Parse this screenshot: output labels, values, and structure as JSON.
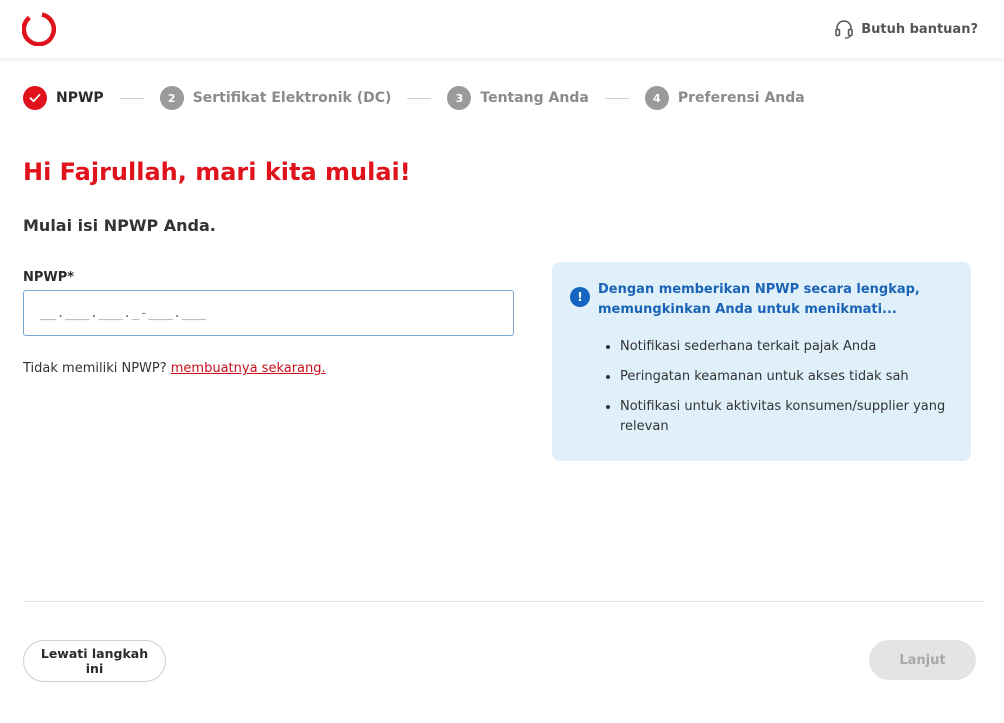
{
  "header": {
    "logo": "brand-ring-logo",
    "help_label": "Butuh bantuan?",
    "help_icon": "headset-icon"
  },
  "stepper": {
    "steps": [
      {
        "number": "1",
        "label": "NPWP",
        "state": "completed"
      },
      {
        "number": "2",
        "label": "Sertifikat Elektronik (DC)",
        "state": "pending"
      },
      {
        "number": "3",
        "label": "Tentang Anda",
        "state": "pending"
      },
      {
        "number": "4",
        "label": "Preferensi Anda",
        "state": "pending"
      }
    ]
  },
  "main": {
    "title": "Hi Fajrullah, mari kita mulai!",
    "subtitle": "Mulai isi NPWP Anda.",
    "npwp_label": "NPWP*",
    "npwp_value": "",
    "npwp_placeholder": "__.___.___._-___.___",
    "no_npwp_text": "Tidak memiliki NPWP?",
    "no_npwp_link": "membuatnya sekarang."
  },
  "info": {
    "icon": "exclamation-icon",
    "title": "Dengan memberikan NPWP secara lengkap, memungkinkan Anda untuk menikmati...",
    "items": [
      "Notifikasi sederhana terkait pajak Anda",
      "Peringatan keamanan untuk akses tidak sah",
      "Notifikasi untuk aktivitas konsumen/supplier yang relevan"
    ]
  },
  "footer": {
    "skip_label": "Lewati langkah ini",
    "next_label": "Lanjut"
  },
  "colors": {
    "brand_red": "#e0121b",
    "info_bg": "#dff0fb",
    "info_text": "#1a63b5"
  }
}
